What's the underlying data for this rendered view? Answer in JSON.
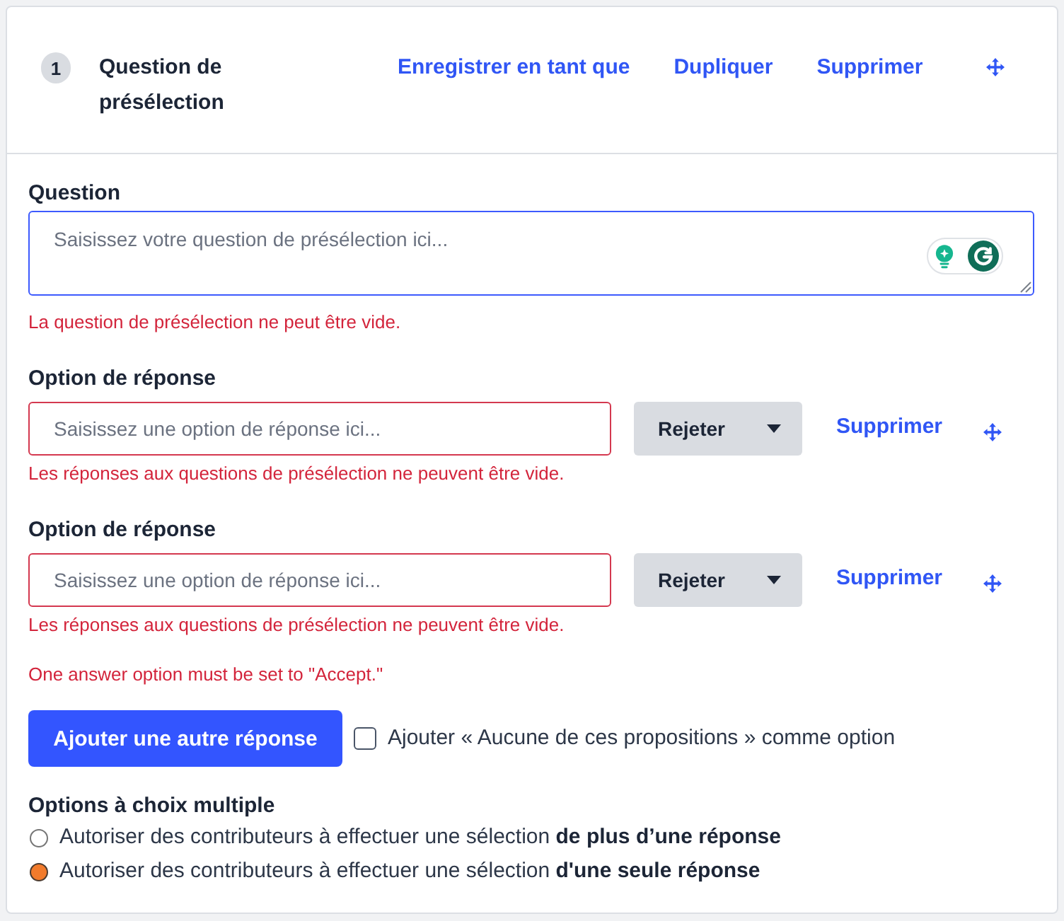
{
  "header": {
    "number": "1",
    "title": "Question de présélection",
    "links": [
      "Enregistrer en tant que",
      "Dupliquer",
      "Supprimer"
    ]
  },
  "question": {
    "label": "Question",
    "placeholder": "Saisissez votre question de présélection ici...",
    "focused": true,
    "error": "La question de présélection ne peut être vide."
  },
  "answer_options": [
    {
      "label": "Option de réponse",
      "placeholder": "Saisissez une option de réponse ici...",
      "invalid": true,
      "status": "Rejeter",
      "delete": "Supprimer",
      "error": "Les réponses aux questions de présélection ne peuvent être vide."
    },
    {
      "label": "Option de réponse",
      "placeholder": "Saisissez une option de réponse ici...",
      "invalid": true,
      "status": "Rejeter",
      "delete": "Supprimer",
      "error": "Les réponses aux questions de présélection ne peuvent être vide."
    }
  ],
  "options_error": "One answer option must be set to \"Accept.\"",
  "add_button": "Ajouter une autre réponse",
  "none_option": {
    "label": "Ajouter « Aucune de ces propositions » comme option",
    "checked": false
  },
  "multiple_choice": {
    "heading": "Options à choix multiple",
    "choices": [
      {
        "label": "Autoriser des contributeurs à effectuer une sélection **de plus d’une réponse**",
        "selected": false
      },
      {
        "label": "Autoriser des contributeurs à effectuer une sélection **d'une seule réponse**",
        "selected": true
      }
    ]
  }
}
